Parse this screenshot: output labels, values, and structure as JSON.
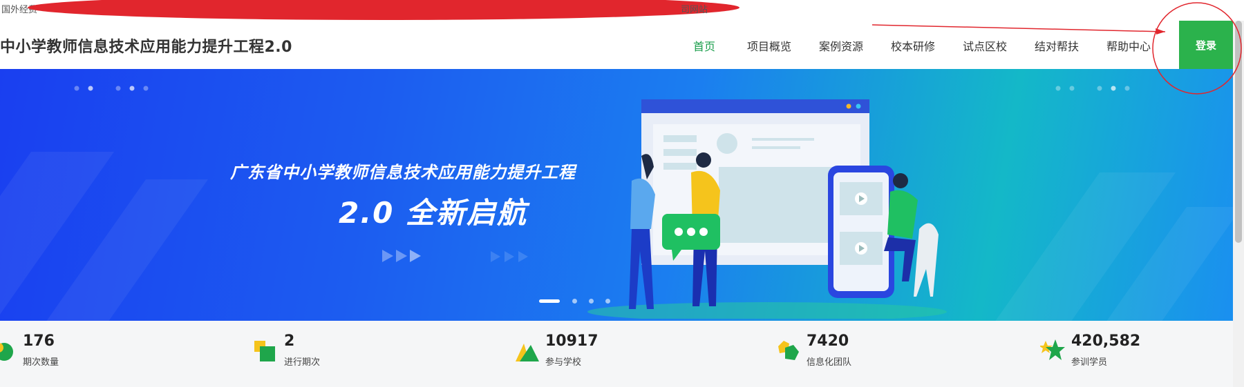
{
  "notice": {
    "left_text": "国外经费",
    "right_text": "司网站"
  },
  "header": {
    "title": "中小学教师信息技术应用能力提升工程2.0",
    "nav": [
      {
        "label": "首页",
        "active": true
      },
      {
        "label": "项目概览",
        "active": false
      },
      {
        "label": "案例资源",
        "active": false
      },
      {
        "label": "校本研修",
        "active": false
      },
      {
        "label": "试点区校",
        "active": false
      },
      {
        "label": "结对帮扶",
        "active": false
      },
      {
        "label": "帮助中心",
        "active": false
      }
    ],
    "login_label": "登录"
  },
  "banner": {
    "headline": "广东省中小学教师信息技术应用能力提升工程",
    "subline": "2.0 全新启航",
    "slide_count": 4,
    "active_slide": 1
  },
  "stats": [
    {
      "value": "176",
      "label": "期次数量",
      "icon": "circle-icon"
    },
    {
      "value": "2",
      "label": "进行期次",
      "icon": "squares-icon"
    },
    {
      "value": "10917",
      "label": "参与学校",
      "icon": "triangle-icon"
    },
    {
      "value": "7420",
      "label": "信息化团队",
      "icon": "hexagon-icon"
    },
    {
      "value": "420,582",
      "label": "参训学员",
      "icon": "star-icon"
    }
  ],
  "colors": {
    "accent_green": "#1a9e4b",
    "login_green": "#2bb24c",
    "banner_blue": "#1c5cf0",
    "annotation_red": "#e1262d"
  }
}
